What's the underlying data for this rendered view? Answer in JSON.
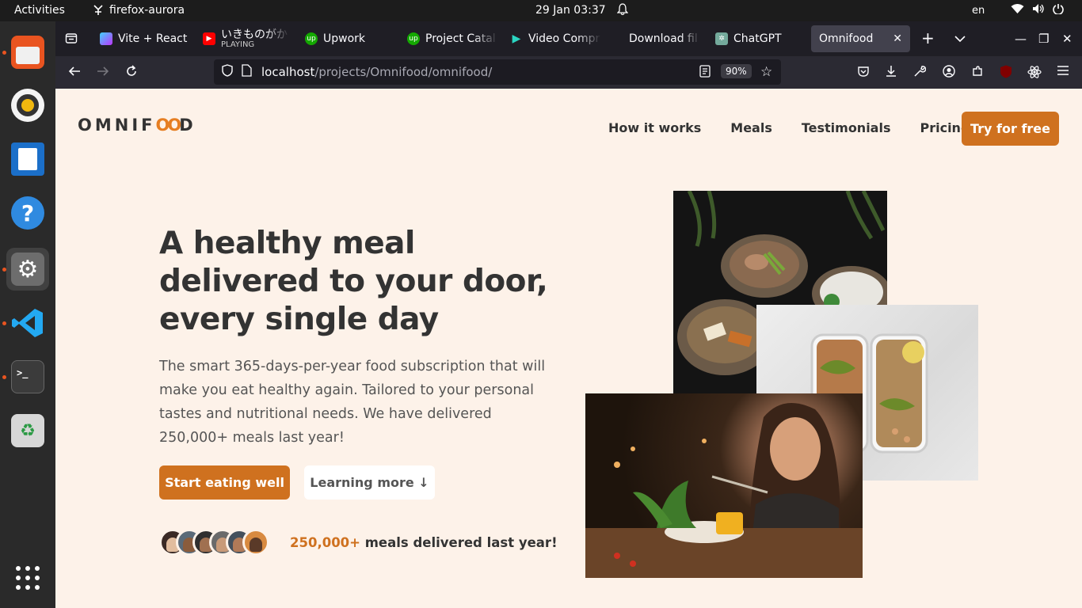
{
  "system": {
    "activities": "Activities",
    "app_name": "firefox-aurora",
    "clock": "29 Jan  03:37",
    "language": "en"
  },
  "browser": {
    "tabs": [
      {
        "label": "Vite + React",
        "icon": "vite-icon"
      },
      {
        "label": "いきものがか",
        "sub": "PLAYING",
        "icon": "youtube-icon"
      },
      {
        "label": "Upwork",
        "icon": "upwork-icon"
      },
      {
        "label": "Project Catal",
        "icon": "upwork-icon"
      },
      {
        "label": "Video Compr",
        "icon": "play-icon"
      },
      {
        "label": "Download fil",
        "icon": ""
      },
      {
        "label": "ChatGPT",
        "icon": "chatgpt-icon"
      },
      {
        "label": "Omnifood",
        "icon": ""
      }
    ],
    "url_host": "localhost",
    "url_path": "/projects/Omnifood/omnifood/",
    "zoom": "90%"
  },
  "site": {
    "logo_before": "OMNIF",
    "logo_oo": "OO",
    "logo_after": "D",
    "nav": [
      "How it works",
      "Meals",
      "Testimonials",
      "Pricing"
    ],
    "cta": "Try for free",
    "hero": {
      "title": "A healthy meal delivered to your door, every single day",
      "description": "The smart 365-days-per-year food subscription that will make you eat healthy again. Tailored to your personal tastes and nutritional needs. We have delivered 250,000+ meals last year!",
      "primary_button": "Start eating well",
      "secondary_button": "Learning more ↓",
      "delivered_number": "250,000+",
      "delivered_text": " meals delivered last year!"
    }
  },
  "colors": {
    "accent": "#cf711f",
    "page_bg": "#fdf2e9",
    "text": "#333333"
  }
}
